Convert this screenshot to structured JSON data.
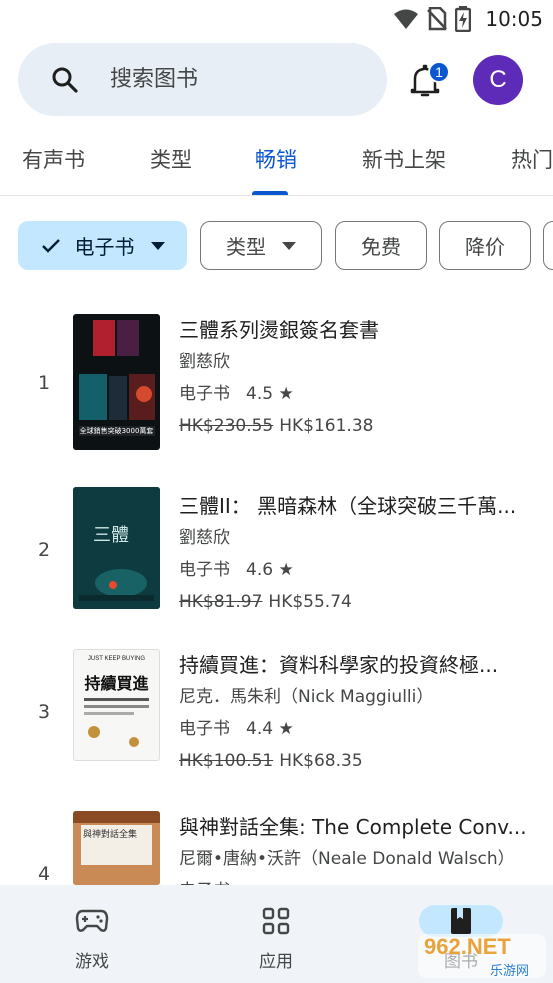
{
  "status_bar": {
    "time": "10:05",
    "icons": [
      "wifi-icon",
      "no-sim-icon",
      "battery-charging-icon"
    ]
  },
  "search": {
    "placeholder": "搜索图书"
  },
  "notifications": {
    "count": "1"
  },
  "account": {
    "initial": "C",
    "color": "#5e2bb8"
  },
  "tabs": [
    {
      "label": "有声书",
      "active": false
    },
    {
      "label": "类型",
      "active": false
    },
    {
      "label": "畅销",
      "active": true
    },
    {
      "label": "新书上架",
      "active": false
    },
    {
      "label": "热门",
      "active": false
    }
  ],
  "filters": [
    {
      "label": "电子书",
      "selected": true,
      "dropdown": true
    },
    {
      "label": "类型",
      "selected": false,
      "dropdown": true
    },
    {
      "label": "免费",
      "selected": false,
      "dropdown": false
    },
    {
      "label": "降价",
      "selected": false,
      "dropdown": false
    }
  ],
  "books": [
    {
      "rank": "1",
      "title": "三體系列燙銀簽名套書",
      "author": "劉慈欣",
      "format": "电子书",
      "rating": "4.5 ★",
      "old_price": "HK$230.55",
      "price": "HK$161.38",
      "cover_text": "全球銷售突破3000萬套"
    },
    {
      "rank": "2",
      "title": "三體II： 黑暗森林（全球突破三千萬...",
      "author": "劉慈欣",
      "format": "电子书",
      "rating": "4.6 ★",
      "old_price": "HK$81.97",
      "price": "HK$55.74",
      "cover_text": "三體"
    },
    {
      "rank": "3",
      "title": "持續買進：資料科學家的投資終極...",
      "author": "尼克．馬朱利（Nick Maggiulli）",
      "format": "电子书",
      "rating": "4.4 ★",
      "old_price": "HK$100.51",
      "price": "HK$68.35",
      "cover_text": "持續買進",
      "cover_subtext": "JUST KEEP BUYING"
    },
    {
      "rank": "4",
      "title": "與神對話全集: The Complete Conv...",
      "author": "尼爾•唐納•沃許（Neale Donald Walsch）",
      "format": "电子书",
      "rating": "",
      "old_price": "",
      "price": "",
      "cover_text": "與神對話全集"
    }
  ],
  "bottom_nav": [
    {
      "label": "游戏",
      "icon": "gamepad-icon",
      "active": false
    },
    {
      "label": "应用",
      "icon": "apps-grid-icon",
      "active": false
    },
    {
      "label": "图书",
      "icon": "book-bookmark-icon",
      "active": true
    }
  ],
  "colors": {
    "accent": "#0b57d0",
    "chip_selected": "#c2e7ff",
    "search_bg": "#e8eef6",
    "nav_bg": "#f0f4f9"
  },
  "watermark": {
    "text": "962.NET",
    "subtext": "乐游网"
  }
}
